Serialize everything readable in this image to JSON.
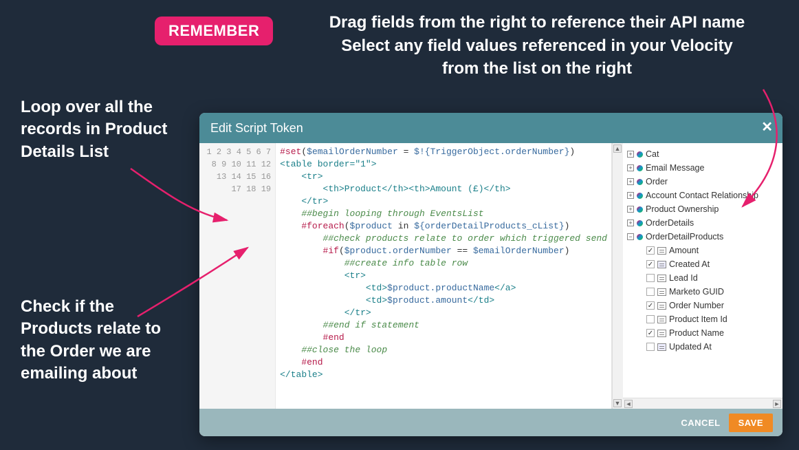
{
  "badge": {
    "label": "REMEMBER"
  },
  "instructions": {
    "line1": "Drag fields from the right to reference their API name",
    "line2": "Select any field values referenced in your Velocity",
    "line3": "from the list on the right"
  },
  "annot1": "Loop over all the records in Product Details List",
  "annot2": "Check if the Products relate to the Order we are emailing about",
  "dialog": {
    "title": "Edit Script Token",
    "close": "✕",
    "buttons": {
      "cancel": "CANCEL",
      "save": "SAVE"
    }
  },
  "code": {
    "l1a": "#set",
    "l1b": "$emailOrderNumber",
    "l1c": " = ",
    "l1d": "$!{TriggerObject.orderNumber}",
    "l2": "<table border=\"1\">",
    "l3": "    <tr>",
    "l4": "        <th>Product</th><th>Amount (£)</th>",
    "l5": "    </tr>",
    "l6": "    ##begin looping through EventsList",
    "l7a": "    #foreach",
    "l7b": "$product",
    "l7c": " in ",
    "l7d": "${orderDetailProducts_cList}",
    "l8": "        ##check products relate to order which triggered send",
    "l9a": "        #if",
    "l9b": "$product.orderNumber",
    "l9c": " == ",
    "l9d": "$emailOrderNumber",
    "l10": "            ##create info table row",
    "l11": "            <tr>",
    "l12a": "                <td>",
    "l12b": "$product.productName",
    "l12c": "</a>",
    "l13a": "                <td>",
    "l13b": "$product.amount",
    "l13c": "</td>",
    "l14": "            </tr>",
    "l15": "        ##end if statement",
    "l16": "        #end",
    "l17": "    ##close the loop",
    "l18": "    #end",
    "l19": "</table>"
  },
  "tree": {
    "nodes": [
      {
        "label": "Cat"
      },
      {
        "label": "Email Message"
      },
      {
        "label": "Order"
      },
      {
        "label": "Account Contact Relationship"
      },
      {
        "label": "Product Ownership"
      },
      {
        "label": "OrderDetails"
      },
      {
        "label": "OrderDetailProducts"
      }
    ],
    "fields": [
      {
        "label": "Amount",
        "checked": true,
        "type": "text"
      },
      {
        "label": "Created At",
        "checked": true,
        "type": "date"
      },
      {
        "label": "Lead Id",
        "checked": false,
        "type": "text"
      },
      {
        "label": "Marketo GUID",
        "checked": false,
        "type": "text"
      },
      {
        "label": "Order Number",
        "checked": true,
        "type": "text"
      },
      {
        "label": "Product Item Id",
        "checked": false,
        "type": "text"
      },
      {
        "label": "Product Name",
        "checked": true,
        "type": "text"
      },
      {
        "label": "Updated At",
        "checked": false,
        "type": "date"
      }
    ]
  },
  "lineNumbers": [
    "1",
    "2",
    "3",
    "4",
    "5",
    "6",
    "7",
    "8",
    "9",
    "10",
    "11",
    "12",
    "13",
    "14",
    "15",
    "16",
    "17",
    "18",
    "19"
  ]
}
